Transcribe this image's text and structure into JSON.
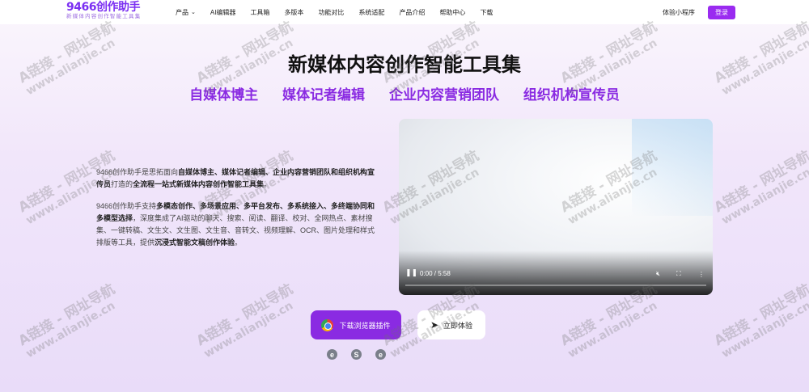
{
  "header": {
    "logo": "9466创作助手",
    "logo_sub": "新媒体内容创作智能工具集",
    "nav": [
      "产品",
      "AI编辑器",
      "工具箱",
      "多版本",
      "功能对比",
      "系统适配",
      "产品介绍",
      "帮助中心",
      "下载"
    ],
    "mini_program": "体验小程序",
    "login": "登录"
  },
  "hero": {
    "title": "新媒体内容创作智能工具集",
    "audiences": [
      "自媒体博主",
      "媒体记者编辑",
      "企业内容营销团队",
      "组织机构宣传员"
    ]
  },
  "description": {
    "p1_a": "9466创作助手是思拓面向",
    "p1_b": "自媒体博主、媒体记者编辑、企业内容营销团队和组织机构宣传员",
    "p1_c": "打造的",
    "p1_d": "全流程一站式新媒体内容创作智能工具集",
    "p1_e": "。",
    "p2_a": "9466创作助手支持",
    "p2_b": "多模态创作、多场景应用、多平台发布、多系统接入、多终端协同和多模型选择",
    "p2_c": "，深度集成了AI驱动的聊天、搜索、阅读、翻译、校对、全网热点、素材搜集、一键转稿、文生文、文生图、文生音、音转文、视频理解、OCR、图片处理和样式排版等工具，提供",
    "p2_d": "沉浸式智能文稿创作体验",
    "p2_e": "。"
  },
  "video": {
    "time": "0:00 / 5:58",
    "progress": 0
  },
  "buttons": {
    "download": "下载浏览器插件",
    "try": "立即体验"
  },
  "browser_icons": [
    "edge-icon",
    "sogou-icon",
    "ie-icon"
  ],
  "watermark": {
    "line1": "A链接 - 网址导航",
    "line2": "www.alianjie.cn"
  },
  "colors": {
    "accent": "#8a2be2",
    "login": "#9a2bf0"
  }
}
